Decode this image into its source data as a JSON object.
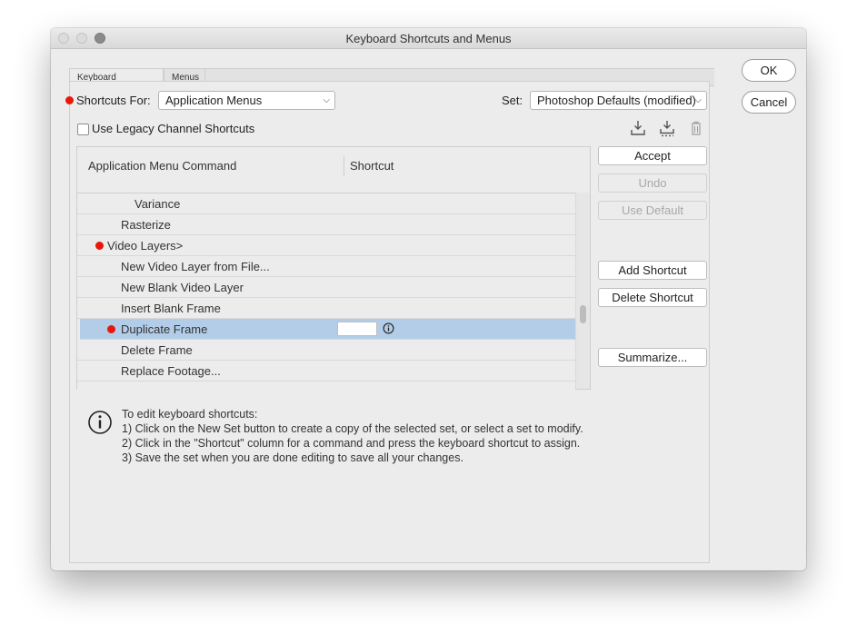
{
  "window": {
    "title": "Keyboard Shortcuts and Menus"
  },
  "tabs": [
    {
      "label": "Keyboard Shortcuts",
      "active": true
    },
    {
      "label": "Menus",
      "active": false
    }
  ],
  "shortcuts_for": {
    "label": "Shortcuts For:",
    "value": "Application Menus"
  },
  "set": {
    "label": "Set:",
    "value": "Photoshop Defaults (modified)"
  },
  "legacy": {
    "label": "Use Legacy Channel Shortcuts",
    "checked": false
  },
  "toolbar": {
    "save_icon": "save-set-icon",
    "save_copy_icon": "save-copy-set-icon",
    "delete_icon": "trash-icon"
  },
  "table": {
    "col_command": "Application Menu Command",
    "col_shortcut": "Shortcut",
    "rows": [
      {
        "text": "Variance",
        "marked": false,
        "selected": false
      },
      {
        "text": "Rasterize",
        "marked": false,
        "selected": false
      },
      {
        "text": "Video Layers>",
        "marked": true,
        "selected": false
      },
      {
        "text": "New Video Layer from File...",
        "marked": false,
        "selected": false
      },
      {
        "text": "New Blank Video Layer",
        "marked": false,
        "selected": false
      },
      {
        "text": "Insert Blank Frame",
        "marked": false,
        "selected": false
      },
      {
        "text": "Duplicate Frame",
        "marked": true,
        "selected": true
      },
      {
        "text": "Delete Frame",
        "marked": false,
        "selected": false
      },
      {
        "text": "Replace Footage...",
        "marked": false,
        "selected": false
      }
    ]
  },
  "side_buttons": {
    "accept": "Accept",
    "undo": "Undo",
    "use_default": "Use Default",
    "add_shortcut": "Add Shortcut",
    "delete_shortcut": "Delete Shortcut",
    "summarize": "Summarize..."
  },
  "dialog_buttons": {
    "ok": "OK",
    "cancel": "Cancel"
  },
  "help": {
    "line1": "To edit keyboard shortcuts:",
    "line2": "1) Click on the New Set button to create a copy of the selected set, or select a set to modify.",
    "line3": "2) Click in the \"Shortcut\" column for a command and press the keyboard shortcut to assign.",
    "line4": "3) Save the set when you are done editing to save all your changes."
  },
  "colors": {
    "marker": "#e8170a",
    "selection": "#b3cde9"
  }
}
